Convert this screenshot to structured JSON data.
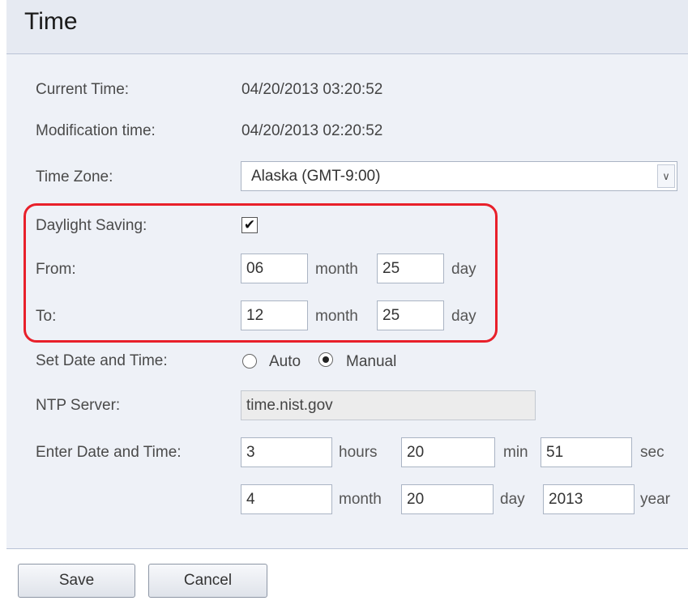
{
  "page": {
    "title": "Time"
  },
  "form": {
    "current_time": {
      "label": "Current Time:",
      "value": "04/20/2013 03:20:52"
    },
    "modification_time": {
      "label": "Modification time:",
      "value": "04/20/2013 02:20:52"
    },
    "time_zone": {
      "label": "Time Zone:",
      "selected": "Alaska (GMT-9:00)"
    },
    "daylight_saving": {
      "label": "Daylight Saving:",
      "checked": true,
      "check_glyph": "✔"
    },
    "from": {
      "label": "From:",
      "month": "06",
      "month_unit": "month",
      "day": "25",
      "day_unit": "day"
    },
    "to": {
      "label": "To:",
      "month": "12",
      "month_unit": "month",
      "day": "25",
      "day_unit": "day"
    },
    "set_date_time": {
      "label": "Set Date and Time:",
      "option_auto": "Auto",
      "option_manual": "Manual",
      "selected": "Manual"
    },
    "ntp_server": {
      "label": "NTP Server:",
      "value": "time.nist.gov"
    },
    "enter_date_time": {
      "label": "Enter Date and Time:",
      "hours": "3",
      "hours_unit": "hours",
      "min": "20",
      "min_unit": "min",
      "sec": "51",
      "sec_unit": "sec",
      "month": "4",
      "month_unit": "month",
      "day": "20",
      "day_unit": "day",
      "year": "2013",
      "year_unit": "year"
    }
  },
  "buttons": {
    "save": "Save",
    "cancel": "Cancel"
  },
  "colors": {
    "highlight": "#e8202a",
    "panel_bg": "#eef1f7",
    "title_bg": "#e6eaf2"
  }
}
